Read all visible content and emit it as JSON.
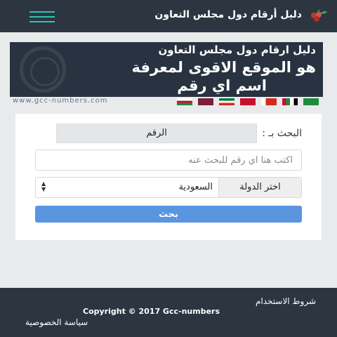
{
  "header": {
    "title": "دليل أرقام دول مجلس التعاون",
    "logo_icon": "grape-icon",
    "menu_icon": "hamburger-menu-icon"
  },
  "banner": {
    "line1": "دليل ارقام دول مجلس التعاون",
    "line2": "هو الموقع الاقوى لمعرفة",
    "line3": "اسم اي رقم",
    "site_url": "www.gcc-numbers.com"
  },
  "flags": [
    {
      "country": "saudi",
      "color": "#1e8a3c"
    },
    {
      "country": "uae",
      "color": "#1e8a3c"
    },
    {
      "country": "bahrain",
      "color": "#d52b1e"
    },
    {
      "country": "qatar",
      "color": "#7b1f3b"
    },
    {
      "country": "kuwait",
      "color": "#0a7a3a"
    },
    {
      "country": "qatar2",
      "color": "#7b1f3b"
    },
    {
      "country": "oman",
      "color": "#c8102e"
    }
  ],
  "form": {
    "search_by_label": "البحث بـ :",
    "search_by_value": "الرقم",
    "search_placeholder": "اكتب هنا اي رقم للبحث عنه",
    "country_label": "اختر الدولة",
    "country_value": "السعودية",
    "submit_label": "بحث"
  },
  "footer": {
    "terms": "شروط الاستخدام",
    "copyright": "Copyright © 2017 Gcc-numbers",
    "privacy": "سياسة الخصوصية"
  },
  "colors": {
    "header_bg": "#2c3540",
    "accent_teal": "#2ec4b6",
    "button_blue": "#5a95e0",
    "page_bg": "#e9eaec"
  }
}
